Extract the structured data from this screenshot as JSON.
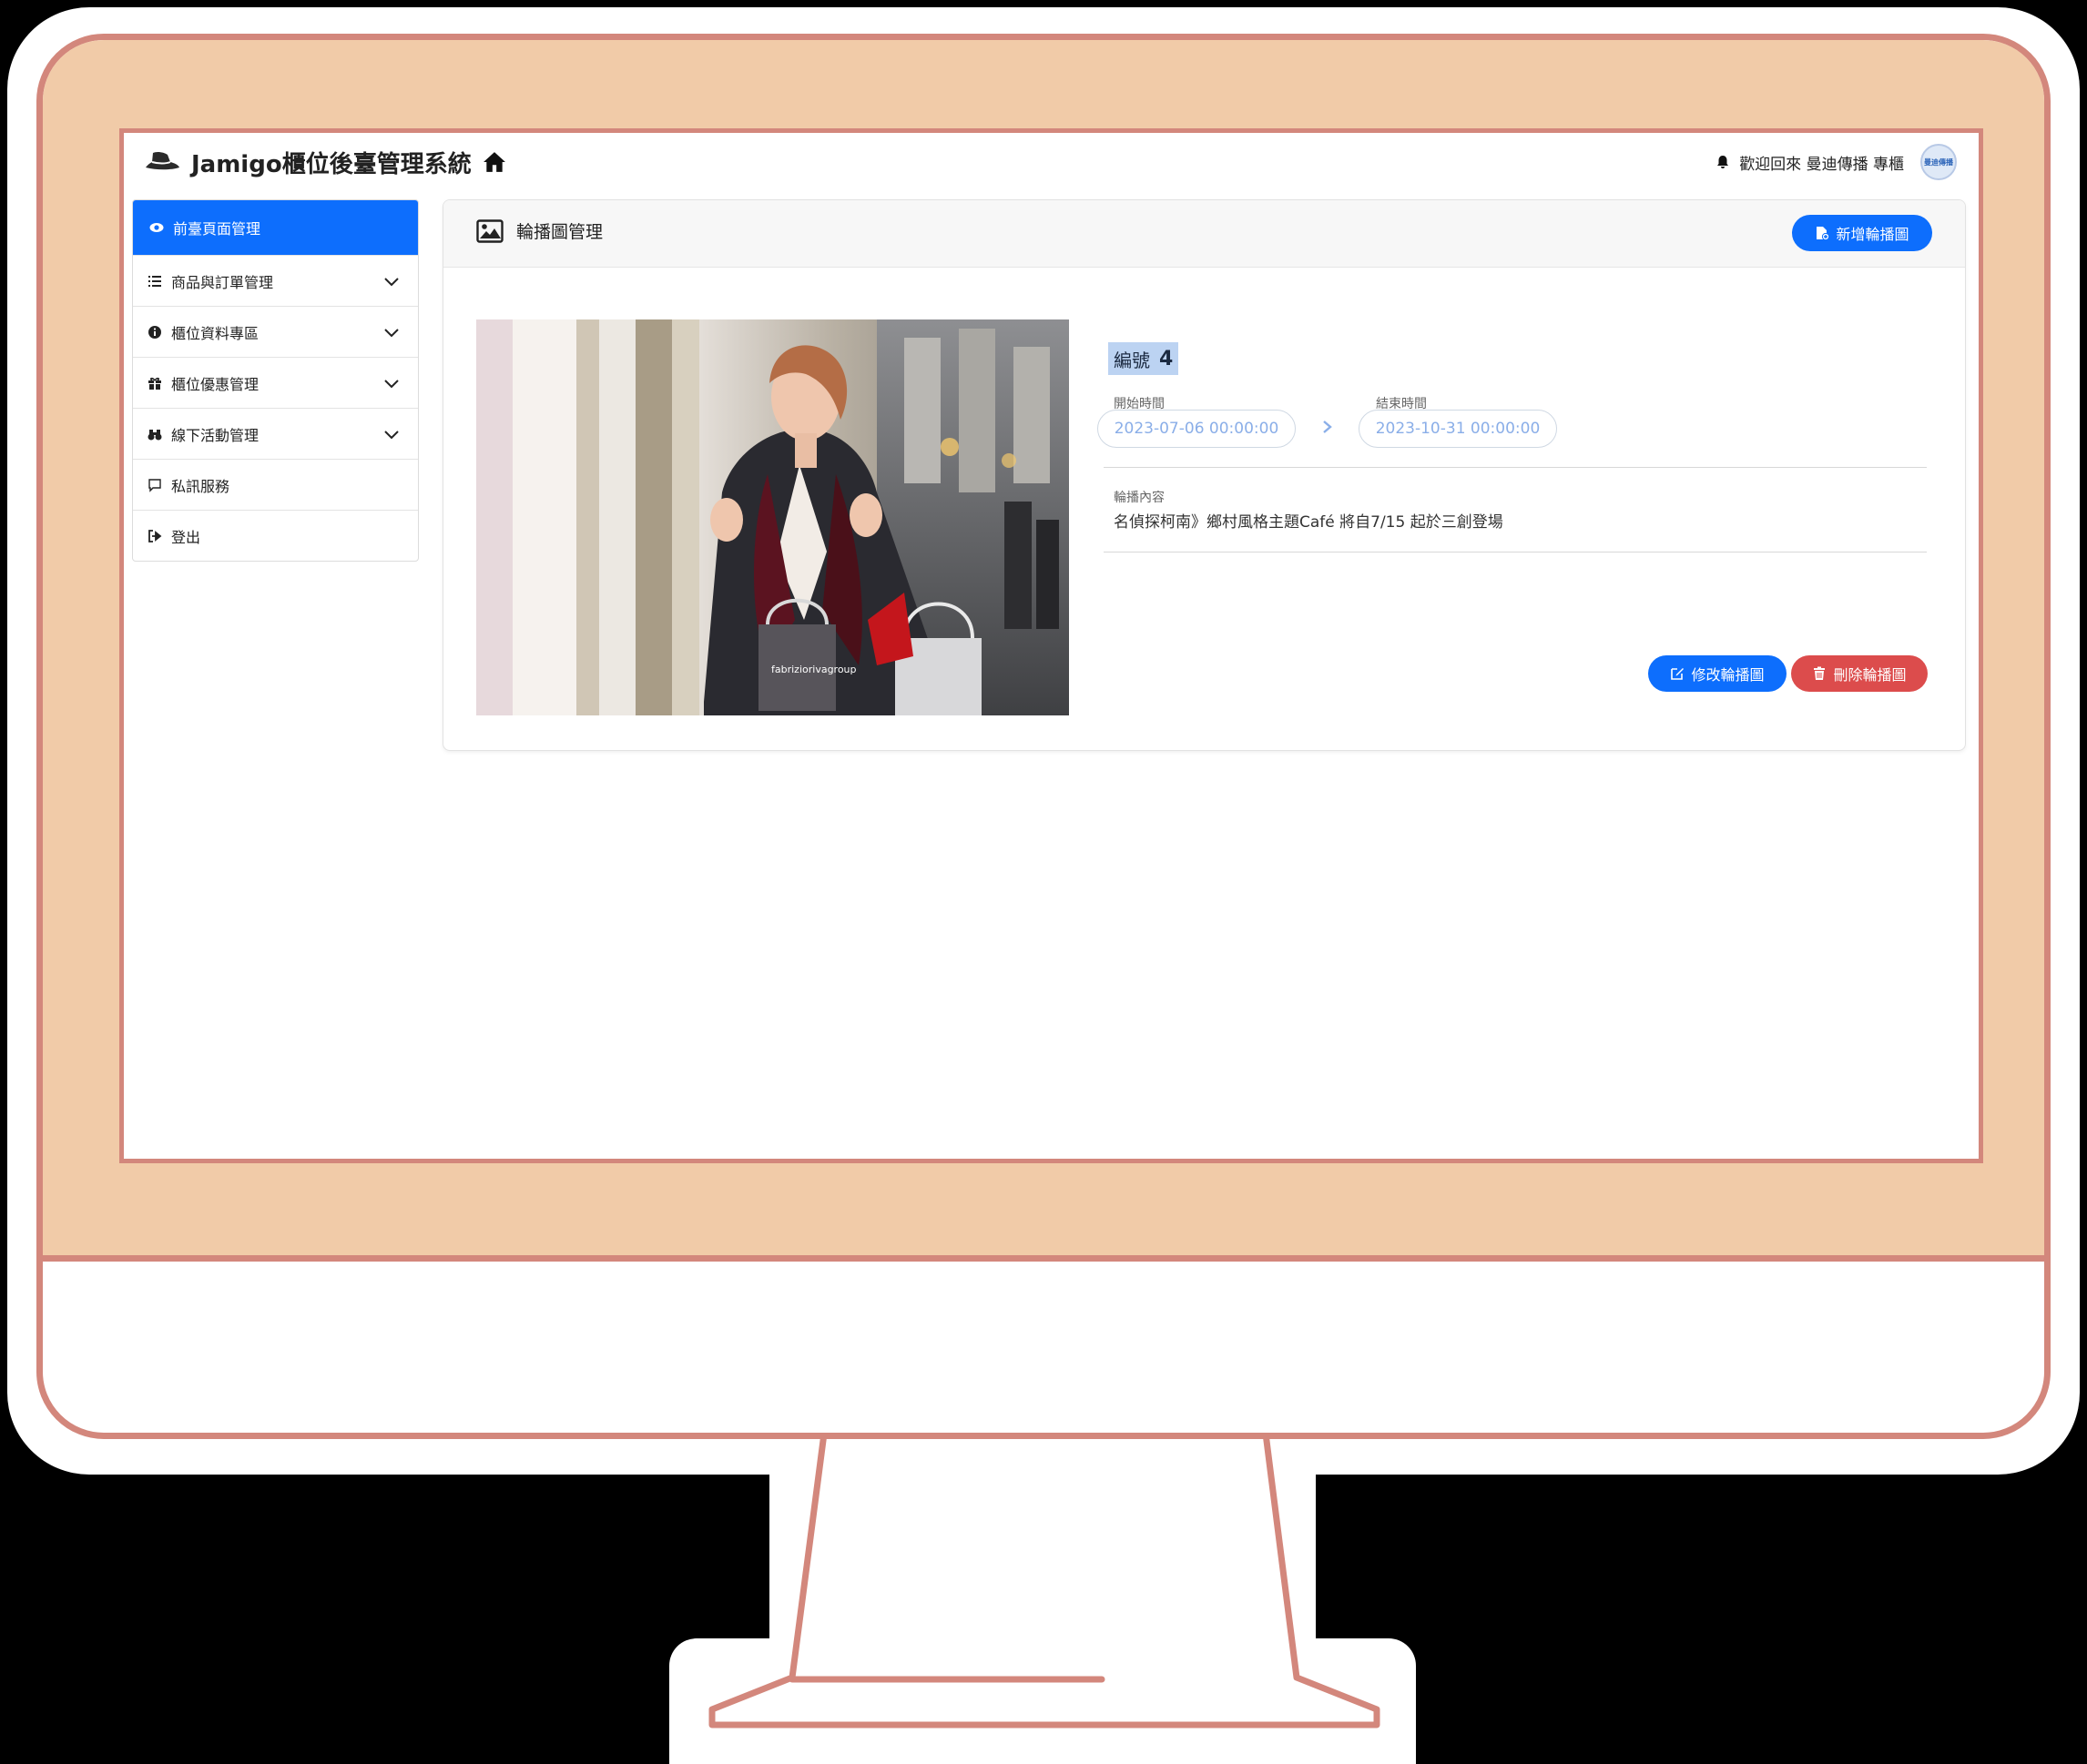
{
  "app": {
    "title": "Jamigo櫃位後臺管理系統",
    "welcome": "歡迎回來 曼迪傳播 專櫃",
    "avatar_text": "曼迪傳播"
  },
  "sidebar": {
    "items": [
      {
        "label": "前臺頁面管理"
      },
      {
        "label": "商品與訂單管理"
      },
      {
        "label": "櫃位資料專區"
      },
      {
        "label": "櫃位優惠管理"
      },
      {
        "label": "線下活動管理"
      },
      {
        "label": "私訊服務"
      },
      {
        "label": "登出"
      }
    ]
  },
  "carousel": {
    "header_title": "輪播圖管理",
    "add_button": "新增輪播圖",
    "id_label": "編號",
    "id_value": "4",
    "start_label": "開始時間",
    "start_value": "2023-07-06 00:00:00",
    "end_label": "結束時間",
    "end_value": "2023-10-31 00:00:00",
    "content_label": "輪播內容",
    "content_value": "名偵探柯南》鄉村風格主題Café 將自7/15 起於三創登場",
    "edit_button": "修改輪播圖",
    "delete_button": "刪除輪播圖",
    "bag_text": "fabriziorivagroup"
  },
  "colors": {
    "primary": "#0d6efd",
    "danger": "#dc4c4c",
    "bezel": "#f1cba8",
    "outline": "#d3877c"
  }
}
